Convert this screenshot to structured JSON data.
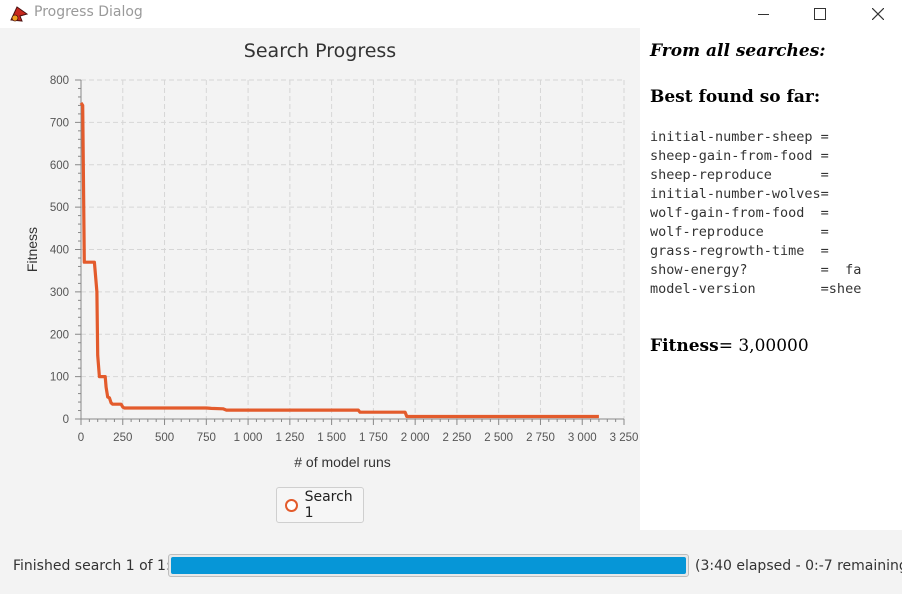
{
  "window": {
    "title": "Progress Dialog",
    "icon": "netlogo-turtle-icon",
    "controls": [
      "minimize-icon",
      "maximize-icon",
      "close-icon"
    ]
  },
  "chart_data": {
    "type": "line",
    "title": "Search Progress",
    "xlabel": "# of model runs",
    "ylabel": "Fitness",
    "xlim": [
      0,
      3250
    ],
    "ylim": [
      0,
      800
    ],
    "x_ticks": [
      "0",
      "250",
      "500",
      "750",
      "1 000",
      "1 250",
      "1 500",
      "1 750",
      "2 000",
      "2 250",
      "2 500",
      "2 750",
      "3 000",
      "3 250"
    ],
    "y_ticks": [
      "0",
      "100",
      "200",
      "300",
      "400",
      "500",
      "600",
      "700",
      "800"
    ],
    "grid": true,
    "legend_position": "bottom",
    "series": [
      {
        "name": "Search 1",
        "color": "#e35b2c",
        "x": [
          0,
          10,
          20,
          80,
          95,
          100,
          110,
          145,
          150,
          160,
          170,
          180,
          190,
          200,
          240,
          250,
          260,
          750,
          780,
          850,
          870,
          1660,
          1670,
          1940,
          1950,
          3100
        ],
        "y": [
          746,
          740,
          370,
          370,
          300,
          150,
          100,
          100,
          75,
          52,
          50,
          38,
          35,
          35,
          35,
          28,
          26,
          26,
          25,
          24,
          21,
          21,
          16,
          16,
          6,
          6
        ]
      }
    ]
  },
  "results": {
    "heading": "From all searches:",
    "best_heading": "Best found so far:",
    "params": [
      "initial-number-sheep =",
      "sheep-gain-from-food =",
      "sheep-reproduce      =",
      "initial-number-wolves=",
      "wolf-gain-from-food  =",
      "wolf-reproduce       =",
      "grass-regrowth-time  =",
      "show-energy?         =  fa",
      "model-version        =shee"
    ],
    "fitness_label": "Fitness",
    "fitness_value": "= 3,00000"
  },
  "status": {
    "label": "Finished search 1 of 1:",
    "progress": 1.0,
    "progress_color": "#0696d7",
    "elapsed": "(3:40 elapsed - 0:-7 remaining)"
  }
}
